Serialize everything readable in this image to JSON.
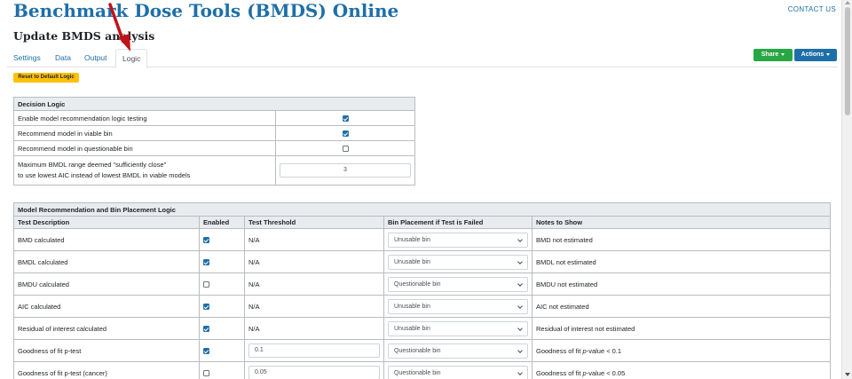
{
  "header": {
    "title": "Benchmark Dose Tools (BMDS) Online",
    "contact": "CONTACT US",
    "subtitle": "Update BMDS analysis"
  },
  "tabs": [
    {
      "label": "Settings"
    },
    {
      "label": "Data"
    },
    {
      "label": "Output"
    },
    {
      "label": "Logic",
      "active": true
    }
  ],
  "toolbar": {
    "share_label": "Share",
    "actions_label": "Actions",
    "reset_label": "Reset to Default Logic"
  },
  "decision_logic": {
    "title": "Decision Logic",
    "rows": [
      {
        "label": "Enable model recommendation logic testing",
        "checked": true
      },
      {
        "label": "Recommend model in viable bin",
        "checked": true
      },
      {
        "label": "Recommend model in questionable bin",
        "checked": false
      }
    ],
    "range_label_line1": "Maximum BMDL range deemed “sufficiently close”",
    "range_label_line2": "to use lowest AIC instead of lowest BMDL in viable models",
    "range_value": "3"
  },
  "recommendation": {
    "title": "Model Recommendation and Bin Placement Logic",
    "columns": [
      "Test Description",
      "Enabled",
      "Test Threshold",
      "Bin Placement if Test is Failed",
      "Notes to Show"
    ],
    "rows": [
      {
        "description": "BMD calculated",
        "enabled": true,
        "threshold": "N/A",
        "bin": "Unusable bin",
        "notes": "BMD not estimated"
      },
      {
        "description": "BMDL calculated",
        "enabled": true,
        "threshold": "N/A",
        "bin": "Unusable bin",
        "notes": "BMDL not estimated"
      },
      {
        "description": "BMDU calculated",
        "enabled": false,
        "threshold": "N/A",
        "bin": "Questionable bin",
        "notes": "BMDU not estimated"
      },
      {
        "description": "AIC calculated",
        "enabled": true,
        "threshold": "N/A",
        "bin": "Unusable bin",
        "notes": "AIC not estimated"
      },
      {
        "description": "Residual of interest calculated",
        "enabled": true,
        "threshold": "N/A",
        "bin": "Unusable bin",
        "notes": "Residual of interest not estimated"
      },
      {
        "description": "Goodness of fit p-test",
        "enabled": true,
        "threshold": "0.1",
        "bin": "Questionable bin",
        "notes_pre": "Goodness of fit ",
        "notes_ital": "p",
        "notes_post": "-value < 0.1"
      },
      {
        "description": "Goodness of fit p-test (cancer)",
        "enabled": false,
        "threshold": "0.05",
        "bin": "Questionable bin",
        "notes_pre": "Goodness of fit ",
        "notes_ital": "p",
        "notes_post": "-value < 0.05"
      }
    ]
  },
  "colors": {
    "primary": "#1e6fa8",
    "share_green": "#28a745",
    "reset_yellow": "#ffc107",
    "arrow_red": "#c0121a"
  }
}
